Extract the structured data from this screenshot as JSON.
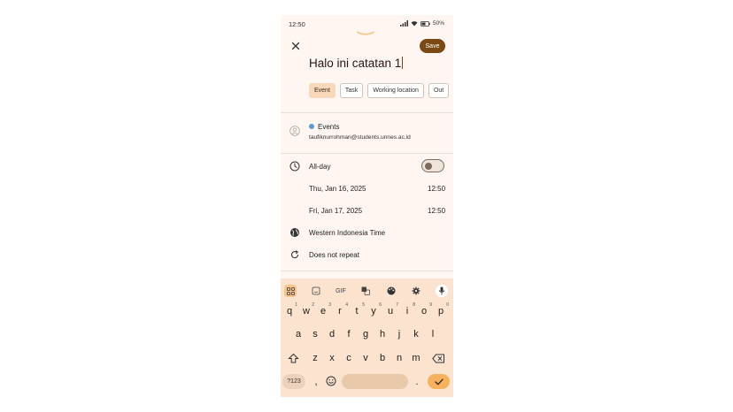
{
  "status_bar": {
    "time": "12:50",
    "battery": "50%"
  },
  "header": {
    "save_label": "Save"
  },
  "title_input": {
    "value": "Halo ini catatan 1"
  },
  "chips": [
    {
      "label": "Event",
      "active": true
    },
    {
      "label": "Task",
      "active": false
    },
    {
      "label": "Working location",
      "active": false
    },
    {
      "label": "Out",
      "active": false
    }
  ],
  "calendar": {
    "name": "Events",
    "account": "taufiknurrohman@students.unnes.ac.id",
    "dot_color": "#5b9bd5"
  },
  "all_day": {
    "label": "All-day",
    "enabled": false
  },
  "start": {
    "date": "Thu, Jan 16, 2025",
    "time": "12:50"
  },
  "end": {
    "date": "Fri, Jan 17, 2025",
    "time": "12:50"
  },
  "timezone": {
    "label": "Western Indonesia Time"
  },
  "repeat": {
    "label": "Does not repeat"
  },
  "keyboard": {
    "toolbar_gif": "GIF",
    "row1": [
      "q",
      "w",
      "e",
      "r",
      "t",
      "y",
      "u",
      "i",
      "o",
      "p"
    ],
    "row1_hints": [
      "1",
      "2",
      "3",
      "4",
      "5",
      "6",
      "7",
      "8",
      "9",
      "0"
    ],
    "row2": [
      "a",
      "s",
      "d",
      "f",
      "g",
      "h",
      "j",
      "k",
      "l"
    ],
    "row3": [
      "z",
      "x",
      "c",
      "v",
      "b",
      "n",
      "m"
    ],
    "symbols_label": "?123",
    "comma": ",",
    "period": "."
  },
  "colors": {
    "accent": "#7b4a14",
    "background": "#fff6f1",
    "keyboard": "#fbe3d0",
    "enter": "#f6b25f"
  }
}
